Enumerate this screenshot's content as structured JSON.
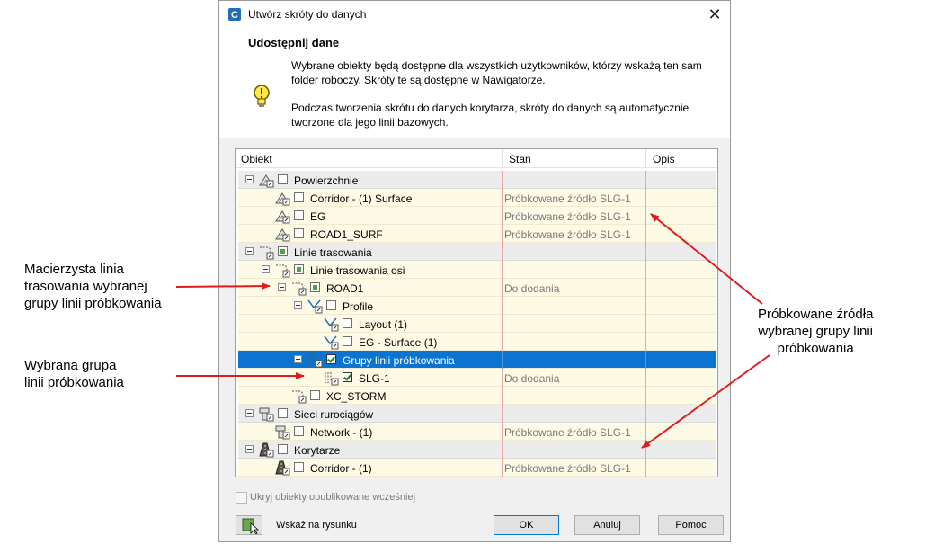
{
  "dialog": {
    "title": "Utwórz skróty do danych",
    "header_title": "Udostępnij dane",
    "info_paragraph_1": "Wybrane obiekty będą dostępne dla wszystkich użytkowników, którzy wskażą ten sam folder roboczy. Skróty te są dostępne w Nawigatorze.",
    "info_paragraph_2": "Podczas tworzenia skrótu do danych korytarza, skróty do danych są automatycznie tworzone dla jego linii bazowych."
  },
  "tree": {
    "columns": [
      "Obiekt",
      "Stan",
      "Opis"
    ],
    "rows": [
      {
        "label": "Powierzchnie",
        "stan": ""
      },
      {
        "label": "Corridor - (1) Surface",
        "stan": "Próbkowane źródło SLG-1"
      },
      {
        "label": "EG",
        "stan": "Próbkowane źródło SLG-1"
      },
      {
        "label": "ROAD1_SURF",
        "stan": "Próbkowane źródło SLG-1"
      },
      {
        "label": "Linie trasowania",
        "stan": ""
      },
      {
        "label": "Linie trasowania osi",
        "stan": ""
      },
      {
        "label": "ROAD1",
        "stan": "Do dodania"
      },
      {
        "label": "Profile",
        "stan": ""
      },
      {
        "label": "Layout (1)",
        "stan": ""
      },
      {
        "label": "EG - Surface (1)",
        "stan": ""
      },
      {
        "label": "Grupy linii próbkowania",
        "stan": ""
      },
      {
        "label": "SLG-1",
        "stan": "Do dodania"
      },
      {
        "label": "XC_STORM",
        "stan": ""
      },
      {
        "label": "Sieci rurociągów",
        "stan": ""
      },
      {
        "label": "Network - (1)",
        "stan": "Próbkowane źródło SLG-1"
      },
      {
        "label": "Korytarze",
        "stan": ""
      },
      {
        "label": "Corridor - (1)",
        "stan": "Próbkowane źródło SLG-1"
      }
    ]
  },
  "footer": {
    "hide_published_label": "Ukryj obiekty opublikowane wcześniej",
    "pick_label": "Wskaż na rysunku",
    "ok_label": "OK",
    "cancel_label": "Anuluj",
    "help_label": "Pomoc"
  },
  "annotations": {
    "parent_alignment": "Macierzysta linia\ntrasowania wybranej\ngrupy linii próbkowania",
    "selected_group": "Wybrana grupa\nlinii próbkowania",
    "sampled_sources": "Próbkowane źródła\nwybranej grupy linii\npróbkowania"
  },
  "colors": {
    "selection": "#0b74d0",
    "row_background": "#fdfbe6",
    "arrow": "#e01b1b"
  }
}
